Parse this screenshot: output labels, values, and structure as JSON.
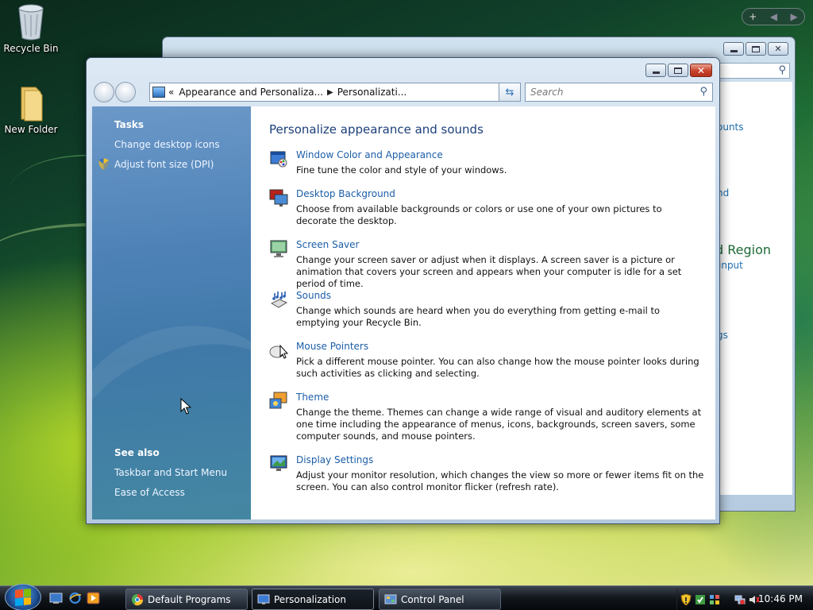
{
  "desktop": {
    "icons": [
      {
        "label": "Recycle Bin"
      },
      {
        "label": "New Folder"
      }
    ]
  },
  "background_window": {
    "visible_texts": [
      "ounts",
      "nd",
      "d Region",
      "input",
      "gs"
    ]
  },
  "window": {
    "address": {
      "overflow": "«",
      "crumb1": "Appearance and Personaliza...",
      "crumb2": "Personalizati..."
    },
    "search_placeholder": "Search",
    "tasks": {
      "heading": "Tasks",
      "links": [
        "Change desktop icons",
        "Adjust font size (DPI)"
      ]
    },
    "see_also": {
      "heading": "See also",
      "links": [
        "Taskbar and Start Menu",
        "Ease of Access"
      ]
    },
    "main_title": "Personalize appearance and sounds",
    "items": [
      {
        "title": "Window Color and Appearance",
        "desc": "Fine tune the color and style of your windows.",
        "icon": "window-color-icon"
      },
      {
        "title": "Desktop Background",
        "desc": "Choose from available backgrounds or colors or use one of your own pictures to decorate the desktop.",
        "icon": "desktop-background-icon"
      },
      {
        "title": "Screen Saver",
        "desc": "Change your screen saver or adjust when it displays. A screen saver is a picture or animation that covers your screen and appears when your computer is idle for a set period of time.",
        "icon": "screen-saver-icon"
      },
      {
        "title": "Sounds",
        "desc": "Change which sounds are heard when you do everything from getting e-mail to emptying your Recycle Bin.",
        "icon": "sounds-icon"
      },
      {
        "title": "Mouse Pointers",
        "desc": "Pick a different mouse pointer. You can also change how the mouse pointer looks during such activities as clicking and selecting.",
        "icon": "mouse-pointers-icon"
      },
      {
        "title": "Theme",
        "desc": "Change the theme. Themes can change a wide range of visual and auditory elements at one time including the appearance of menus, icons, backgrounds, screen savers, some computer sounds, and mouse pointers.",
        "icon": "theme-icon"
      },
      {
        "title": "Display Settings",
        "desc": "Adjust your monitor resolution, which changes the view so more or fewer items fit on the screen. You can also control monitor flicker (refresh rate).",
        "icon": "display-settings-icon"
      }
    ]
  },
  "taskbar": {
    "buttons": [
      {
        "label": "Default Programs"
      },
      {
        "label": "Personalization"
      },
      {
        "label": "Control Panel"
      }
    ],
    "clock": "10:46 PM"
  },
  "colors": {
    "link": "#1c5ea8",
    "heading": "#1c3f7a",
    "taskpane": "#4e82b7"
  }
}
